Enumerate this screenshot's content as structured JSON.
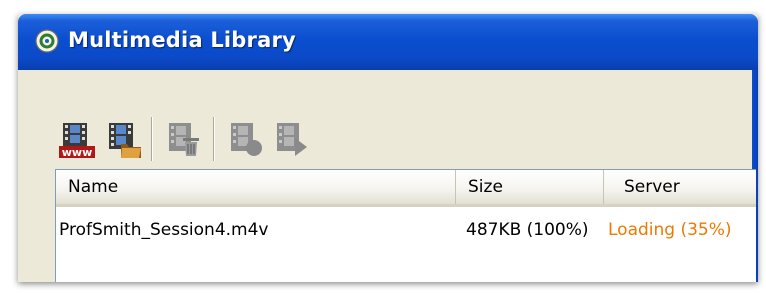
{
  "window": {
    "title": "Multimedia Library"
  },
  "toolbar": {
    "buttons": [
      {
        "name": "add-from-web",
        "label": "www"
      },
      {
        "name": "add-from-folder"
      },
      {
        "name": "delete"
      },
      {
        "name": "record"
      },
      {
        "name": "play"
      }
    ]
  },
  "table": {
    "columns": [
      "Name",
      "Size",
      "Server"
    ],
    "rows": [
      {
        "name": "ProfSmith_Session4.m4v",
        "size": "487KB (100%)",
        "server": "Loading (35%)"
      }
    ]
  },
  "colors": {
    "title_bar": "#0a4fd0",
    "window_bg": "#ece9d8",
    "loading_text": "#f07800"
  }
}
